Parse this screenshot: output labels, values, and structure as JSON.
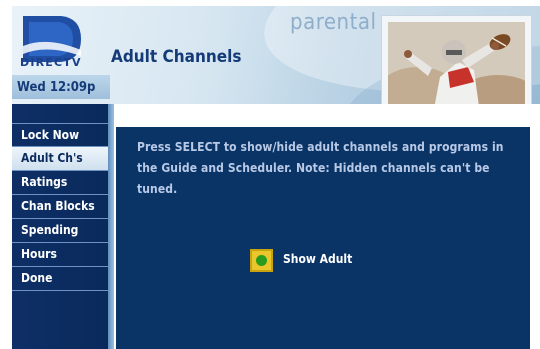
{
  "header": {
    "brand": "DIRECTV",
    "section": "parental",
    "title": "Adult Channels",
    "datetime": "Wed 12:09p"
  },
  "sidebar": {
    "items": [
      {
        "label": "Lock Now",
        "active": false
      },
      {
        "label": "Adult Ch's",
        "active": true
      },
      {
        "label": "Ratings",
        "active": false
      },
      {
        "label": "Chan Blocks",
        "active": false
      },
      {
        "label": "Spending",
        "active": false
      },
      {
        "label": "Hours",
        "active": false
      },
      {
        "label": "Done",
        "active": false
      }
    ]
  },
  "main": {
    "instructions": "Press SELECT to show/hide adult channels and programs in the Guide and Scheduler. Note: Hidden channels can't be tuned.",
    "toggle": {
      "label": "Show Adult",
      "on": true
    }
  },
  "colors": {
    "panel": "#0b3466",
    "sidebar": "#0e2f66",
    "title": "#153a78",
    "toggle_box": "#e8c62c",
    "toggle_on": "#2b9b1d"
  },
  "icons": {
    "logo": "directv-logo-icon",
    "photo": "football-player-photo"
  }
}
